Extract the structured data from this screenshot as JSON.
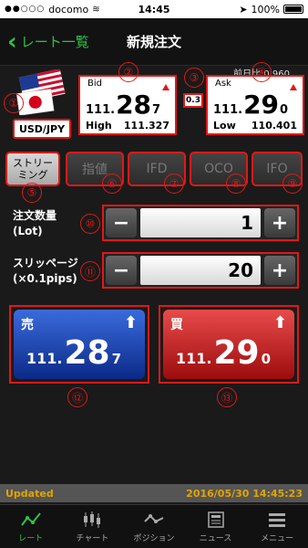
{
  "status_bar": {
    "signal": "●●○○○",
    "carrier": "docomo",
    "wifi": "≋",
    "time": "14:45",
    "battery": "100%"
  },
  "nav": {
    "back_label": "レート一覧",
    "title": "新規注文"
  },
  "quote": {
    "prev_day_label": "前日比",
    "prev_day_value": "0.960",
    "pair": "USD/JPY",
    "spread": "0.3",
    "bid": {
      "label": "Bid",
      "base": "111.",
      "pips": "28",
      "fraction": "7",
      "sub_label": "High",
      "sub_value": "111.327"
    },
    "ask": {
      "label": "Ask",
      "base": "111.",
      "pips": "29",
      "fraction": "0",
      "sub_label": "Low",
      "sub_value": "110.401"
    }
  },
  "order_types": [
    {
      "label": "ストリーミング",
      "line1": "ストリー",
      "line2": "ミング",
      "active": true
    },
    {
      "label": "指値",
      "active": false
    },
    {
      "label": "IFD",
      "active": false
    },
    {
      "label": "OCO",
      "active": false
    },
    {
      "label": "IFO",
      "active": false
    }
  ],
  "quantity": {
    "label_line1": "注文数量",
    "label_line2": "(Lot)",
    "value": "1",
    "minus": "−",
    "plus": "+"
  },
  "slippage": {
    "label_line1": "スリッページ",
    "label_line2": "(×0.1pips)",
    "value": "20",
    "minus": "−",
    "plus": "+"
  },
  "sell": {
    "label": "売",
    "arrow": "⬆",
    "base": "111.",
    "pips": "28",
    "fraction": "7"
  },
  "buy": {
    "label": "買",
    "arrow": "⬆",
    "base": "111.",
    "pips": "29",
    "fraction": "0"
  },
  "annotations": [
    "①",
    "②",
    "③",
    "④",
    "⑤",
    "⑥",
    "⑦",
    "⑧",
    "⑨",
    "⑩",
    "⑪",
    "⑫",
    "⑬"
  ],
  "update_bar": {
    "label": "Updated",
    "timestamp": "2016/05/30 14:45:23"
  },
  "tab_bar": [
    {
      "label": "レート",
      "icon": "rate-chart-icon",
      "active": true
    },
    {
      "label": "チャート",
      "icon": "candlestick-icon",
      "active": false
    },
    {
      "label": "ポジション",
      "icon": "position-icon",
      "active": false
    },
    {
      "label": "ニュース",
      "icon": "news-icon",
      "active": false
    },
    {
      "label": "メニュー",
      "icon": "menu-icon",
      "active": false
    }
  ],
  "colors": {
    "accent_green": "#2ec34a",
    "highlight_red": "#e01818",
    "sell_blue": "#0b2a88",
    "buy_red": "#9d0c0c",
    "timestamp_amber": "#e0a500"
  }
}
